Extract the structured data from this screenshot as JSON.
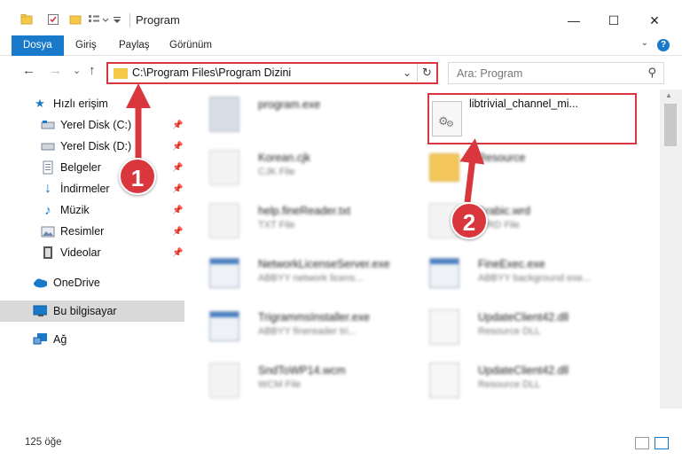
{
  "window": {
    "title": "Program",
    "minimize": "—",
    "maximize": "☐",
    "close": "✕"
  },
  "ribbon": {
    "tabs": [
      {
        "label": "Dosya",
        "active": true
      },
      {
        "label": "Giriş"
      },
      {
        "label": "Paylaş"
      },
      {
        "label": "Görünüm"
      }
    ],
    "help": "?",
    "collapse": "⌄"
  },
  "navigation": {
    "back": "←",
    "forward": "→",
    "recent": "⌄",
    "up": "↑",
    "address": "C:\\Program Files\\Program Dizini",
    "address_dropdown": "⌄",
    "refresh": "↻",
    "search_placeholder": "Ara: Program",
    "search_icon": "⚲"
  },
  "sidebar": {
    "quick_access": {
      "label": "Hızlı erişim",
      "icon": "star-icon"
    },
    "items": [
      {
        "label": "Yerel Disk (C:)",
        "icon": "drive-icon",
        "pinned": true
      },
      {
        "label": "Yerel Disk (D:)",
        "icon": "drive-icon",
        "pinned": true
      },
      {
        "label": "Belgeler",
        "icon": "documents-icon",
        "pinned": true
      },
      {
        "label": "İndirmeler",
        "icon": "downloads-icon",
        "pinned": true
      },
      {
        "label": "Müzik",
        "icon": "music-icon",
        "pinned": true
      },
      {
        "label": "Resimler",
        "icon": "pictures-icon",
        "pinned": true
      },
      {
        "label": "Videolar",
        "icon": "videos-icon",
        "pinned": true
      }
    ],
    "onedrive": {
      "label": "OneDrive",
      "icon": "cloud-icon"
    },
    "this_pc": {
      "label": "Bu bilgisayar",
      "icon": "computer-icon",
      "selected": true
    },
    "network": {
      "label": "Ağ",
      "icon": "network-icon"
    },
    "pin_glyph": "📌"
  },
  "files": {
    "left": [
      {
        "name": "program.exe",
        "type": "",
        "icon": "exe"
      },
      {
        "name": "Korean.cjk",
        "type": "CJK File",
        "icon": "doc"
      },
      {
        "name": "help.fineReader.txt",
        "type": "TXT File",
        "icon": "doc"
      },
      {
        "name": "NetworkLicenseServer.exe",
        "type": "ABBYY network licens...",
        "icon": "app"
      },
      {
        "name": "TrigrammsInstaller.exe",
        "type": "ABBYY finereader tri...",
        "icon": "app"
      },
      {
        "name": "SndToWP14.wcm",
        "type": "WCM File",
        "icon": "doc"
      }
    ],
    "right": [
      {
        "name": "Resource",
        "type": "",
        "icon": "folder"
      },
      {
        "name": "Arabic.wrd",
        "type": "WRD File",
        "icon": "doc"
      },
      {
        "name": "FineExec.exe",
        "type": "ABBYY background exe...",
        "icon": "app"
      },
      {
        "name": "UpdateClient42.dll",
        "type": "Resource DLL",
        "icon": "dll"
      },
      {
        "name": "UpdateClient42.dll",
        "type": "Resource DLL",
        "icon": "dll"
      }
    ],
    "selected": {
      "name": "libtrivial_channel_mi...",
      "icon": "gear-file-icon"
    }
  },
  "annotations": {
    "step1": "1",
    "step2": "2",
    "color": "#d9363e"
  },
  "status": {
    "count": "125 öğe"
  },
  "colors": {
    "accent": "#1979ca",
    "highlight": "#d9363e",
    "folder": "#f6c848"
  }
}
